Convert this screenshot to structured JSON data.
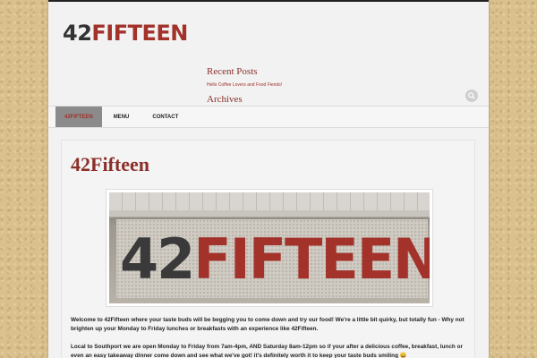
{
  "site": {
    "logo_num": "42",
    "logo_word": "FIFTEEN"
  },
  "widgets": {
    "recent_posts_title": "Recent Posts",
    "recent_post_link": "Hello Coffee Lovers and Food Fiends!",
    "archives_title": "Archives"
  },
  "nav": {
    "items": [
      "42FIFTEEN",
      "MENU",
      "CONTACT"
    ]
  },
  "post": {
    "title": "42Fifteen",
    "photo_sign_num": "42",
    "photo_sign_word": "FIFTEEN",
    "paragraph1": "Welcome to 42Fifteen where your taste buds will be begging you to come down and try our food! We're a little bit quirky, but totally fun - Why not brighten up your Monday to Friday lunches or breakfasts with an experience like 42Fifteen.",
    "paragraph2": "Local to Southport we are open Monday to Friday from 7am-4pm, AND Saturday 8am-12pm so if your after a delicious coffee, breakfast, lunch or even an easy takeaway dinner come down and see what we've got! it's definitely worth it to keep your taste buds smiling",
    "smiley": "😀"
  },
  "colors": {
    "brand_red": "#a2322a",
    "background": "#d9c08c"
  }
}
